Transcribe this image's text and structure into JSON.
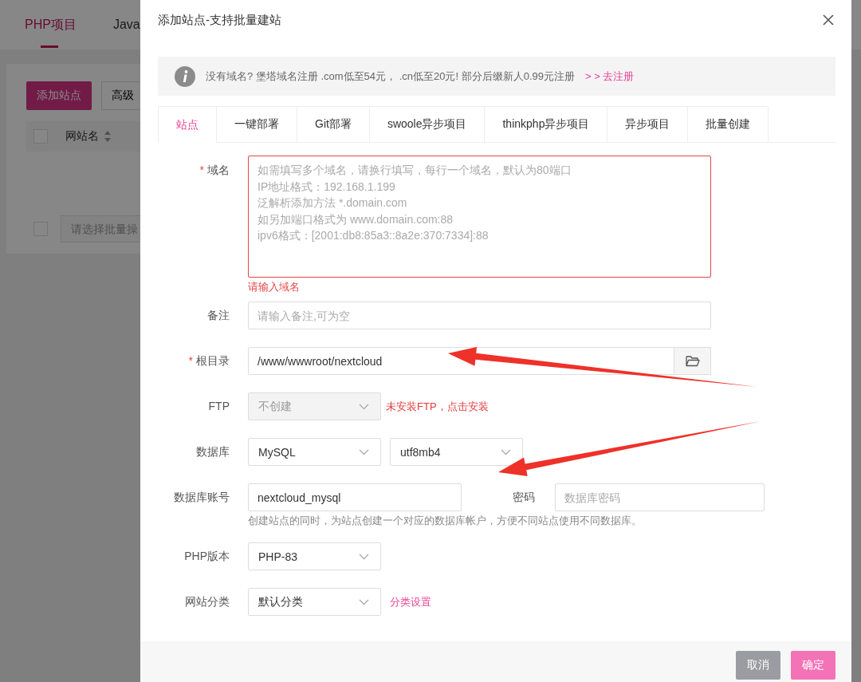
{
  "background_page": {
    "tabs": [
      {
        "label": "PHP项目",
        "selected": true
      },
      {
        "label": "Java",
        "selected": false
      }
    ],
    "add_site_button": "添加站点",
    "advanced_button": "高级",
    "table_header": {
      "checked": false,
      "column": "网站名"
    },
    "batch_select": {
      "checked": false,
      "placeholder": "请选择批量操"
    }
  },
  "dialog": {
    "title": "添加站点-支持批量建站",
    "notice": {
      "text": "没有域名? 堡塔域名注册 .com低至54元， .cn低至20元! 部分后缀新人0.99元注册",
      "link": "> > 去注册"
    },
    "tabs": [
      {
        "label": "站点",
        "selected": true
      },
      {
        "label": "一键部署",
        "selected": false
      },
      {
        "label": "Git部署",
        "selected": false
      },
      {
        "label": "swoole异步项目",
        "selected": false
      },
      {
        "label": "thinkphp异步项目",
        "selected": false
      },
      {
        "label": "异步项目",
        "selected": false
      },
      {
        "label": "批量创建",
        "selected": false
      }
    ],
    "form": [
      {
        "kind": "textarea",
        "required_mark": "*",
        "label": "域名",
        "placeholder": "如需填写多个域名，请换行填写，每行一个域名，默认为80端口\nIP地址格式：192.168.1.199\n泛解析添加方法 *.domain.com\n如另加端口格式为 www.domain.com:88\nipv6格式：[2001:db8:85a3::8a2e:370:7334]:88",
        "error": "请输入域名"
      },
      {
        "kind": "input",
        "label": "备注",
        "placeholder": "请输入备注,可为空"
      },
      {
        "kind": "path",
        "required_mark": "*",
        "label": "根目录",
        "value": "/www/wwwroot/nextcloud"
      },
      {
        "kind": "selects",
        "label": "FTP",
        "selects": [
          {
            "value": "不创建",
            "disabled": true
          }
        ],
        "note": {
          "text": "未安装FTP，点击安装",
          "kind": "error"
        }
      },
      {
        "kind": "selects",
        "label": "数据库",
        "selects": [
          {
            "value": "MySQL",
            "disabled": false
          },
          {
            "value": "utf8mb4",
            "disabled": false
          }
        ]
      },
      {
        "kind": "account",
        "label": "数据库账号",
        "value": "nextcloud_mysql",
        "password_label": "密码",
        "password_placeholder": "数据库密码",
        "help": "创建站点的同时，为站点创建一个对应的数据库帐户，方便不同站点使用不同数据库。"
      },
      {
        "kind": "selects",
        "label": "PHP版本",
        "selects": [
          {
            "value": "PHP-83",
            "disabled": false
          }
        ]
      },
      {
        "kind": "selects",
        "label": "网站分类",
        "selects": [
          {
            "value": "默认分类",
            "disabled": false
          }
        ],
        "note": {
          "text": "分类设置",
          "kind": "link"
        }
      }
    ],
    "buttons": [
      {
        "label": "取消",
        "kind": "secondary"
      },
      {
        "label": "确定",
        "kind": "primary"
      }
    ]
  }
}
